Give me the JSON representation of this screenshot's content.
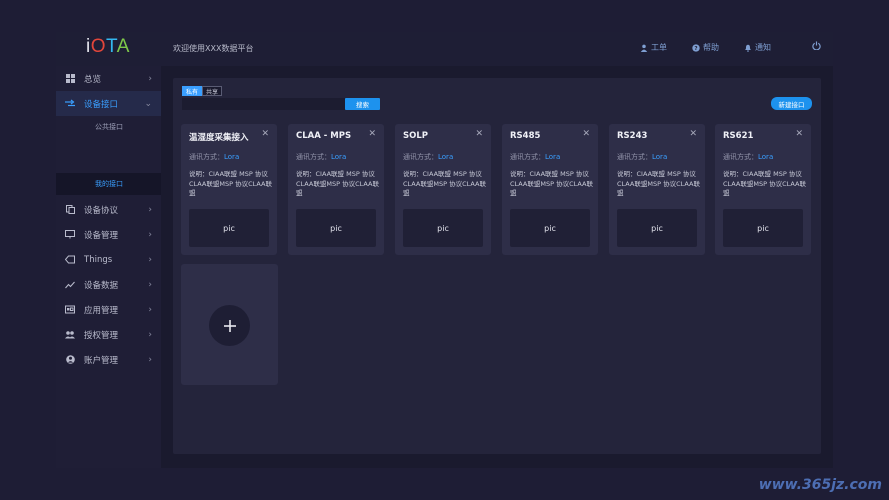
{
  "header": {
    "logo": {
      "i": "i",
      "o": "O",
      "t": "T",
      "a": "A"
    },
    "welcome": "欢迎使用XXX数据平台",
    "links": [
      {
        "label": "工单",
        "icon": "user-icon"
      },
      {
        "label": "帮助",
        "icon": "help-icon"
      },
      {
        "label": "通知",
        "icon": "bell-icon"
      }
    ],
    "power_icon": "power-icon"
  },
  "sidebar": {
    "items": [
      {
        "label": "总览",
        "icon": "grid-icon"
      },
      {
        "label": "设备接口",
        "icon": "interface-icon"
      },
      {
        "label": "设备协议",
        "icon": "copy-icon"
      },
      {
        "label": "设备管理",
        "icon": "monitor-icon"
      },
      {
        "label": "Things",
        "icon": "tag-icon"
      },
      {
        "label": "设备数据",
        "icon": "trend-icon"
      },
      {
        "label": "应用管理",
        "icon": "app-icon"
      },
      {
        "label": "授权管理",
        "icon": "people-icon"
      },
      {
        "label": "账户管理",
        "icon": "account-icon"
      }
    ],
    "sub_items": [
      {
        "label": "公共接口"
      },
      {
        "label": "我的接口"
      }
    ]
  },
  "main": {
    "tabs": [
      {
        "label": "私有"
      },
      {
        "label": "共享"
      }
    ],
    "search": {
      "value": "",
      "button": "搜索"
    },
    "new_button": "新建接口",
    "comm_label": "通讯方式：",
    "cards": [
      {
        "title": "温湿度采集接入",
        "comm_value": "Lora",
        "desc": "说明：CIAA联盟  MSP  协议CLAA联盟MSP    协议CLAA联盟",
        "pic": "pic"
      },
      {
        "title": "CLAA - MPS",
        "comm_value": "Lora",
        "desc": "说明：CIAA联盟  MSP  协议CLAA联盟MSP    协议CLAA联盟",
        "pic": "pic"
      },
      {
        "title": "SOLP",
        "comm_value": "Lora",
        "desc": "说明：CIAA联盟  MSP  协议CLAA联盟MSP    协议CLAA联盟",
        "pic": "pic"
      },
      {
        "title": "RS485",
        "comm_value": "Lora",
        "desc": "说明：CIAA联盟  MSP  协议CLAA联盟MSP    协议CLAA联盟",
        "pic": "pic"
      },
      {
        "title": "RS243",
        "comm_value": "Lora",
        "desc": "说明：CIAA联盟  MSP  协议CLAA联盟MSP    协议CLAA联盟",
        "pic": "pic"
      },
      {
        "title": "RS621",
        "comm_value": "Lora",
        "desc": "说明：CIAA联盟  MSP  协议CLAA联盟MSP    协议CLAA联盟",
        "pic": "pic"
      }
    ]
  },
  "watermark": "www.365jz.com",
  "colors": {
    "accent": "#3a9fff",
    "button": "#1d92ee",
    "background": "#1a1a2e",
    "card": "#2e2e48",
    "logo_i": "#e4e4ee",
    "logo_o": "#e3463a",
    "logo_t": "#34b8f0",
    "logo_a": "#7ec84a"
  }
}
